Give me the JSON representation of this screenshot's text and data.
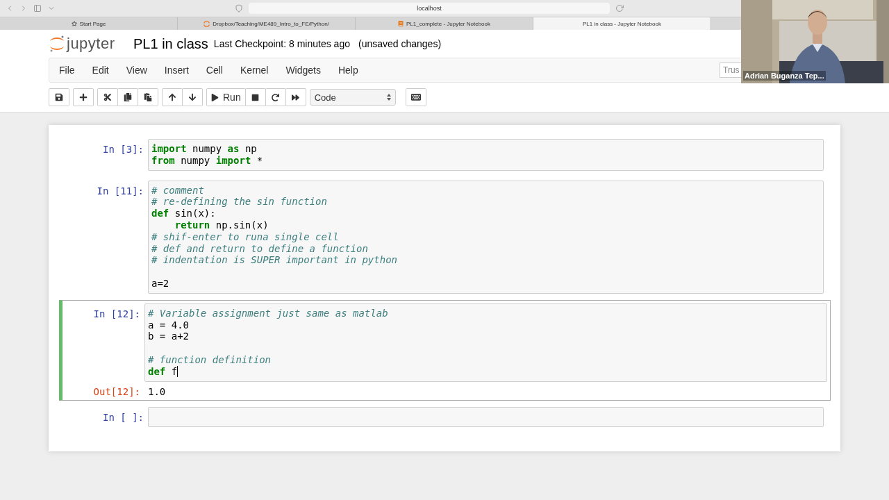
{
  "browser": {
    "address": "localhost",
    "tabs": [
      {
        "label": "Start Page",
        "kind": "favorite",
        "selected": false
      },
      {
        "label": "Dropbox/Teaching/ME489_Intro_to_FE/Python/",
        "kind": "folder",
        "selected": false
      },
      {
        "label": "PL1_complete - Jupyter Notebook",
        "kind": "notebook",
        "selected": false
      },
      {
        "label": "PL1 in class - Jupyter Notebook",
        "kind": "plain",
        "selected": true
      }
    ]
  },
  "header": {
    "logo": "jupyter",
    "title": "PL1 in class",
    "checkpoint": "Last Checkpoint: 8 minutes ago",
    "status": "(unsaved changes)"
  },
  "menu": [
    "File",
    "Edit",
    "View",
    "Insert",
    "Cell",
    "Kernel",
    "Widgets",
    "Help"
  ],
  "trusted_button": "Trus",
  "toolbar": {
    "run_label": "Run",
    "cell_type": "Code"
  },
  "cells": [
    {
      "prompt": "In [3]:",
      "selected": false,
      "lines": [
        {
          "kind": "code",
          "text": "**import** numpy **as** np"
        },
        {
          "kind": "code",
          "text": "**from** numpy **import** *"
        }
      ]
    },
    {
      "prompt": "In [11]:",
      "selected": false,
      "lines": [
        {
          "kind": "comment",
          "text": "# comment"
        },
        {
          "kind": "comment",
          "text": "# re-defining the sin function"
        },
        {
          "kind": "code",
          "text": "**def** sin(x):"
        },
        {
          "kind": "code",
          "text": "    **return** np.sin(x)"
        },
        {
          "kind": "comment",
          "text": "# shif-enter to runa single cell"
        },
        {
          "kind": "comment",
          "text": "# def and return to define a function"
        },
        {
          "kind": "comment",
          "text": "# indentation is SUPER important in python"
        },
        {
          "kind": "blank"
        },
        {
          "kind": "code",
          "text": "a=2"
        }
      ]
    },
    {
      "prompt": "In [12]:",
      "selected": true,
      "lines": [
        {
          "kind": "comment",
          "text": "# Variable assignment just same as matlab"
        },
        {
          "kind": "code",
          "text": "a = 4.0"
        },
        {
          "kind": "code",
          "text": "b = a+2"
        },
        {
          "kind": "blank"
        },
        {
          "kind": "comment",
          "text": "# function definition"
        },
        {
          "kind": "code",
          "text": "**def** f"
        }
      ],
      "output": {
        "prompt": "Out[12]:",
        "text": "1.0"
      }
    },
    {
      "prompt": "In [ ]:",
      "selected": false
    }
  ],
  "video": {
    "kind": "picture",
    "name": "Adrian Buganza Tep..."
  }
}
